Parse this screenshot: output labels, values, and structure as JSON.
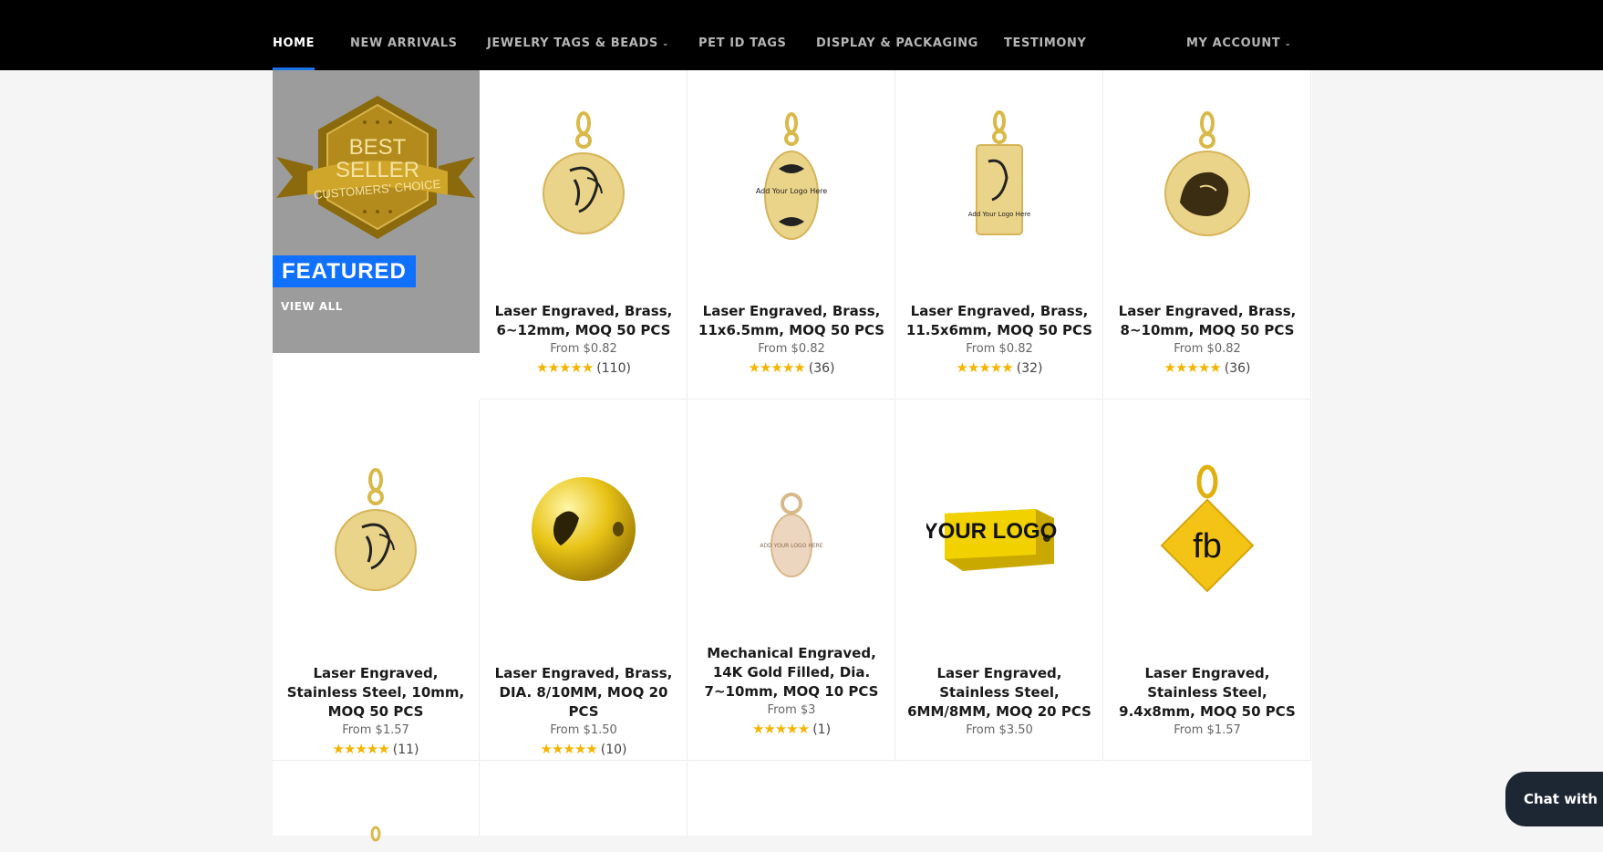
{
  "nav": {
    "items": [
      {
        "label": "HOME",
        "active": true
      },
      {
        "label": "NEW ARRIVALS"
      },
      {
        "label": "JEWELRY TAGS & BEADS",
        "dropdown": true
      },
      {
        "label": "PET ID TAGS"
      },
      {
        "label": "DISPLAY & PACKAGING"
      },
      {
        "label": "TESTIMONY"
      }
    ],
    "account": "MY ACCOUNT"
  },
  "featured": {
    "badge_line1": "BEST",
    "badge_line2": "SELLER",
    "ribbon": "CUSTOMERS' CHOICE",
    "label": "FEATURED",
    "view_all": "VIEW ALL"
  },
  "products": [
    {
      "title": "Laser Engraved, Brass, 6~12mm, MOQ 50 PCS",
      "price": "From $0.82",
      "reviews": "(110)",
      "image": "round-logo-pendant"
    },
    {
      "title": "Laser Engraved, Brass, 11x6.5mm, MOQ 50 PCS",
      "price": "From $0.82",
      "reviews": "(36)",
      "image": "oval-logo-pendant",
      "image_text": "Add Your Logo Here"
    },
    {
      "title": "Laser Engraved, Brass, 11.5x6mm, MOQ 50 PCS",
      "price": "From $0.82",
      "reviews": "(32)",
      "image": "rectangle-logo-pendant",
      "image_text": "Add Your Logo Here"
    },
    {
      "title": "Laser Engraved, Brass, 8~10mm, MOQ 50 PCS",
      "price": "From $0.82",
      "reviews": "(36)",
      "image": "lion-round-pendant"
    },
    {
      "title": "Laser Engraved, Stainless Steel, 10mm, MOQ 50 PCS",
      "price": "From $1.57",
      "reviews": "(11)",
      "image": "round-logo-pendant"
    },
    {
      "title": "Laser Engraved, Brass, DIA. 8/10MM, MOQ 20 PCS",
      "price": "From $1.50",
      "reviews": "(10)",
      "image": "gold-bead"
    },
    {
      "title": "Mechanical Engraved, 14K Gold Filled, Dia. 7~10mm, MOQ 10 PCS",
      "price": "From $3",
      "reviews": "(1)",
      "image": "rose-gold-disc",
      "image_text": "ADD YOUR LOGO HERE"
    },
    {
      "title": "Laser Engraved, Stainless Steel, 6MM/8MM, MOQ 20 PCS",
      "price": "From $3.50",
      "reviews": "",
      "image": "rect-bar-bead",
      "image_text": "YOUR LOGO"
    },
    {
      "title": "Laser Engraved, Stainless Steel, 9.4x8mm, MOQ 50 PCS",
      "price": "From $1.57",
      "reviews": "",
      "image": "diamond-tag",
      "image_text": "fb"
    }
  ],
  "chat": {
    "label": "Chat with us"
  },
  "colors": {
    "accent": "#1070ff",
    "gold": "#e6c85a",
    "star": "#f5b400"
  }
}
